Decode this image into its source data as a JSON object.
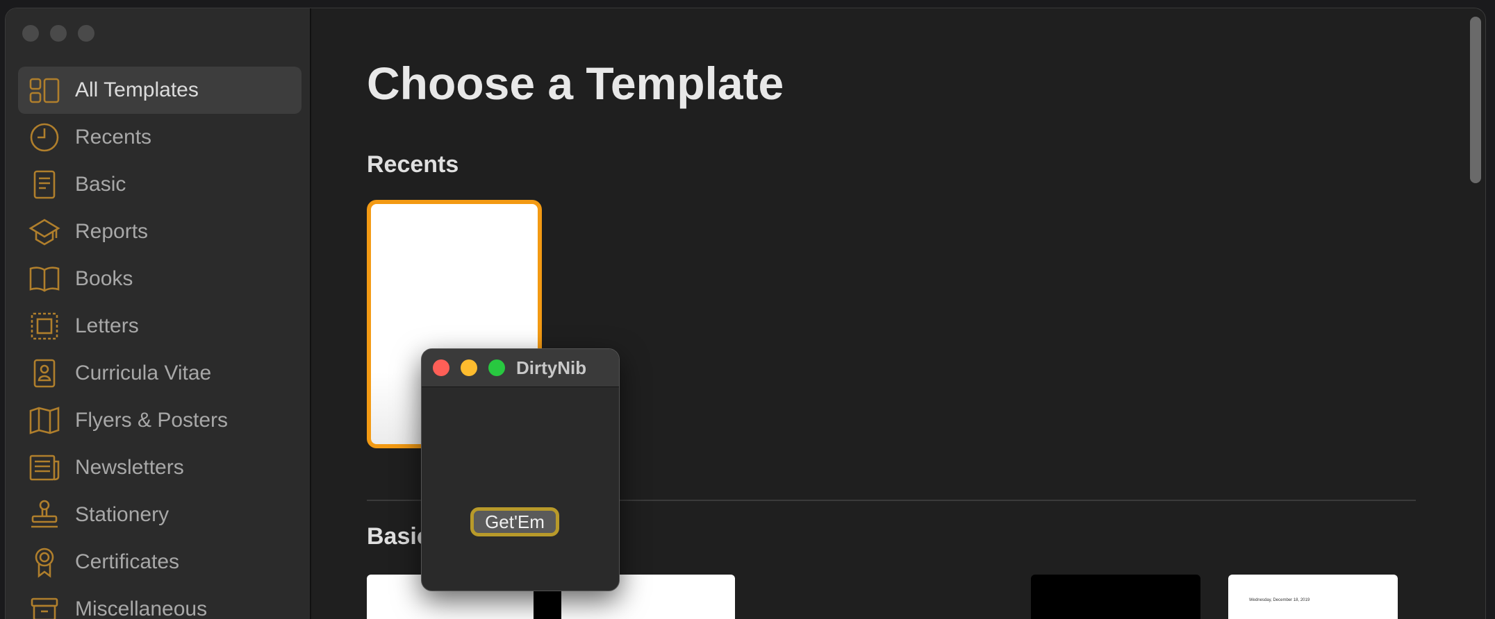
{
  "sidebar": {
    "items": [
      {
        "label": "All Templates",
        "icon": "templates-icon",
        "selected": true
      },
      {
        "label": "Recents",
        "icon": "clock-icon"
      },
      {
        "label": "Basic",
        "icon": "document-icon"
      },
      {
        "label": "Reports",
        "icon": "graduation-cap-icon"
      },
      {
        "label": "Books",
        "icon": "book-icon"
      },
      {
        "label": "Letters",
        "icon": "stamp-letter-icon"
      },
      {
        "label": "Curricula Vitae",
        "icon": "badge-person-icon"
      },
      {
        "label": "Flyers & Posters",
        "icon": "map-icon"
      },
      {
        "label": "Newsletters",
        "icon": "newspaper-icon"
      },
      {
        "label": "Stationery",
        "icon": "rubber-stamp-icon"
      },
      {
        "label": "Certificates",
        "icon": "ribbon-icon"
      },
      {
        "label": "Miscellaneous",
        "icon": "drawer-icon"
      }
    ],
    "icon_color": "#b07f2c"
  },
  "main": {
    "title": "Choose a Template",
    "recents_heading": "Recents",
    "basic_heading": "Basic",
    "thumb_date": "Wednesday, December 18, 2019",
    "accent": "#f39a13"
  },
  "dialog": {
    "title": "DirtyNib",
    "button_label": "Get'Em"
  }
}
